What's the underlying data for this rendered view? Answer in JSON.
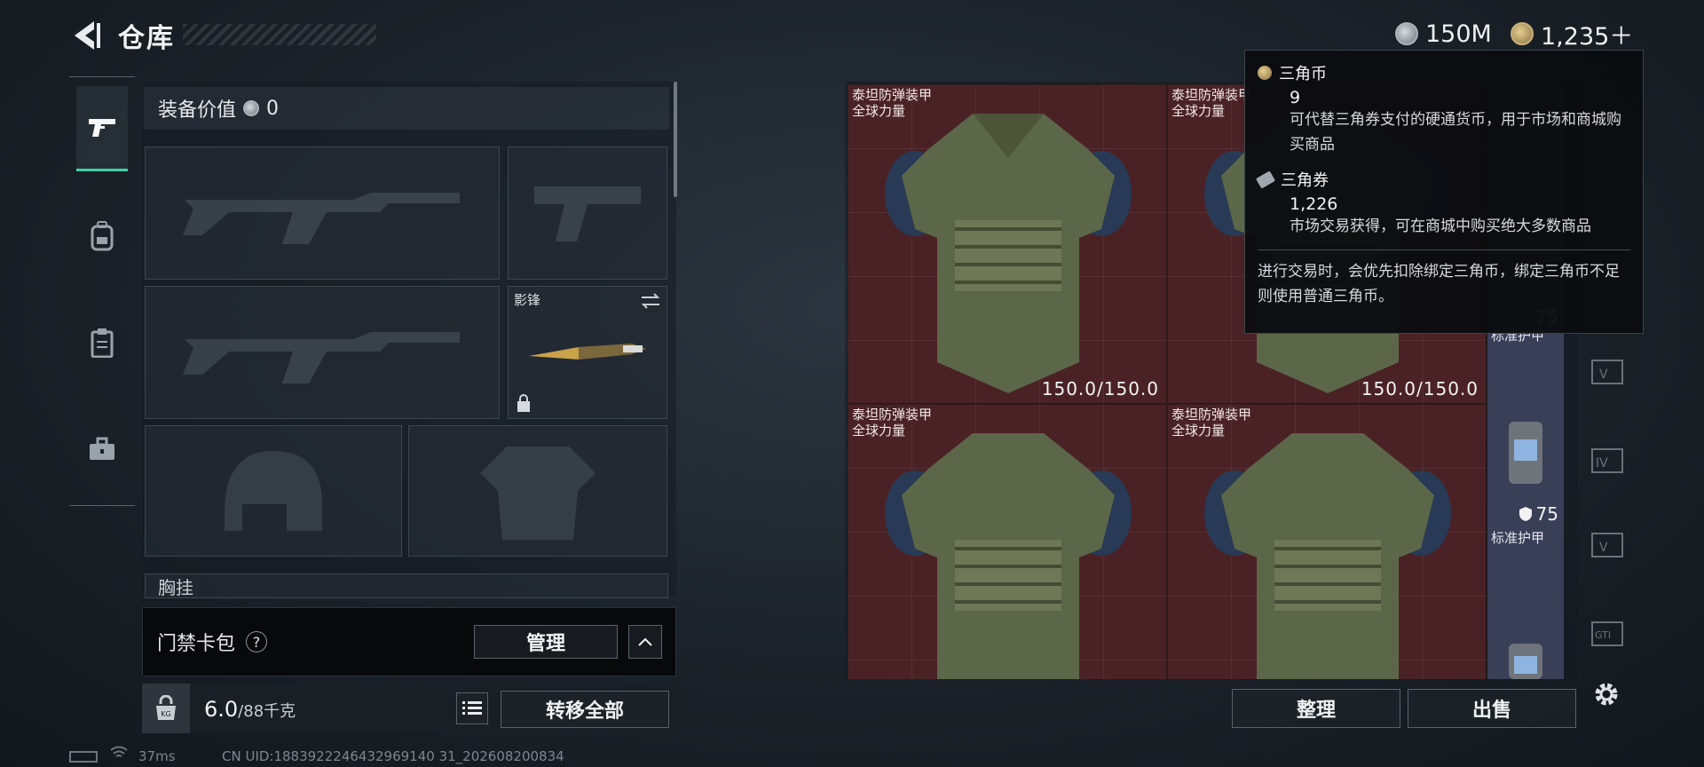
{
  "header": {
    "title": "仓库",
    "currencies": [
      {
        "icon": "silver-coin-icon",
        "value": "150M"
      },
      {
        "icon": "gold-coin-icon",
        "value": "1,235＋"
      }
    ]
  },
  "equip": {
    "value_label": "装备价值",
    "value": "0",
    "melee_slot_label": "影锋",
    "chest_rig_label": "胸挂"
  },
  "card_bar": {
    "title": "门禁卡包",
    "help": "?",
    "manage_label": "管理"
  },
  "weight": {
    "current": "6.0",
    "max": "/88千克",
    "kg_icon": "KG",
    "transfer_all_label": "转移全部"
  },
  "storage": {
    "items": [
      {
        "name": "泰坦防弹装甲",
        "brand": "全球力量",
        "durability": "150.0/150.0"
      },
      {
        "name": "泰坦防弹装甲",
        "brand": "全球力量",
        "durability": "150.0/150.0"
      },
      {
        "name": "泰坦防弹装甲",
        "brand": "全球力量",
        "durability": ""
      },
      {
        "name": "泰坦防弹装甲",
        "brand": "全球力量",
        "durability": ""
      }
    ],
    "side_items": [
      {
        "label": "标准护甲",
        "value": "75"
      },
      {
        "label": "标准护甲",
        "value": "75"
      }
    ],
    "sort_label": "整理",
    "sell_label": "出售"
  },
  "tooltip": {
    "coin_name": "三角币",
    "coin_amount": "9",
    "coin_desc": "可代替三角券支付的硬通货币，用于市场和商城购买商品",
    "ticket_name": "三角券",
    "ticket_amount": "1,226",
    "ticket_desc": "市场交易获得，可在商城中购买绝大多数商品",
    "note": "进行交易时，会优先扣除绑定三角币，绑定三角币不足则使用普通三角币。"
  },
  "status": {
    "latency": "37ms",
    "uid": "CN UID:1883922246432969140 31_202608200834"
  },
  "colors": {
    "accent": "#3fd1a8",
    "storage_bg": "#4a2226",
    "side_bg": "#3a3f58"
  }
}
